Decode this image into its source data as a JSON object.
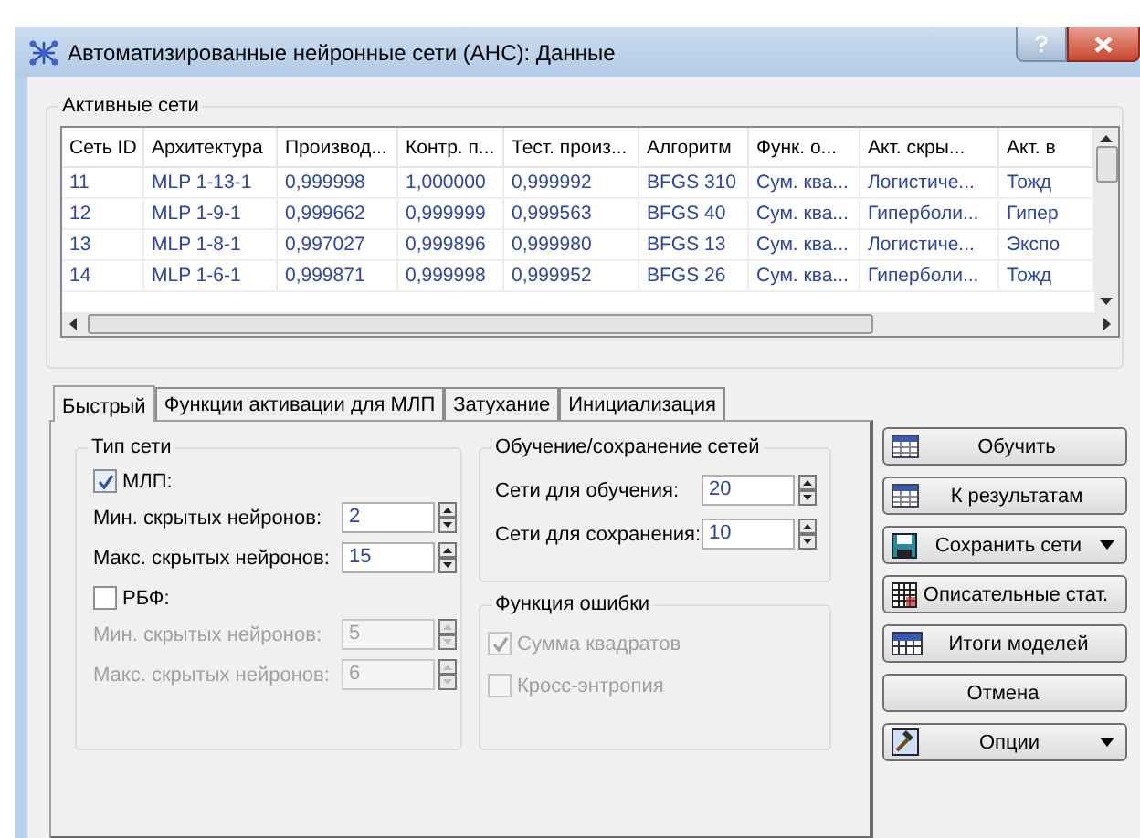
{
  "window": {
    "title": "Автоматизированные нейронные сети (АНС): Данные"
  },
  "active_networks": {
    "title": "Активные сети",
    "columns": [
      "Сеть ID",
      "Архитектура",
      "Производ...",
      "Контр. п...",
      "Тест. произ...",
      "Алгоритм",
      "Функ. о...",
      "Акт. скры...",
      "Акт. в"
    ],
    "rows": [
      [
        "11",
        "MLP 1-13-1",
        "0,999998",
        "1,000000",
        "0,999992",
        "BFGS 310",
        "Сум. ква...",
        "Логистиче...",
        "Тожд"
      ],
      [
        "12",
        "MLP 1-9-1",
        "0,999662",
        "0,999999",
        "0,999563",
        "BFGS 40",
        "Сум. ква...",
        "Гиперболи...",
        "Гипер"
      ],
      [
        "13",
        "MLP 1-8-1",
        "0,997027",
        "0,999896",
        "0,999980",
        "BFGS 13",
        "Сум. ква...",
        "Логистиче...",
        "Экспо"
      ],
      [
        "14",
        "MLP 1-6-1",
        "0,999871",
        "0,999998",
        "0,999952",
        "BFGS 26",
        "Сум. ква...",
        "Гиперболи...",
        "Тожд"
      ]
    ]
  },
  "tabs": [
    {
      "label": "Быстрый",
      "selected": true
    },
    {
      "label": "Функции активации для МЛП",
      "selected": false
    },
    {
      "label": "Затухание",
      "selected": false
    },
    {
      "label": "Инициализация",
      "selected": false
    }
  ],
  "network_type": {
    "title": "Тип сети",
    "sections": [
      {
        "label": "МЛП:",
        "checked": true,
        "fields": [
          {
            "label": "Мин. скрытых нейронов:",
            "value": "2",
            "disabled": false
          },
          {
            "label": "Макс. скрытых нейронов:",
            "value": "15",
            "disabled": false
          }
        ]
      },
      {
        "label": "РБФ:",
        "checked": false,
        "fields": [
          {
            "label": "Мин. скрытых нейронов:",
            "value": "5",
            "disabled": true
          },
          {
            "label": "Макс. скрытых нейронов:",
            "value": "6",
            "disabled": true
          }
        ]
      }
    ]
  },
  "training": {
    "title": "Обучение/сохранение сетей",
    "fields": [
      {
        "label": "Сети для обучения:",
        "value": "20",
        "disabled": false
      },
      {
        "label": "Сети для сохранения:",
        "value": "10",
        "disabled": false
      }
    ]
  },
  "error_function": {
    "title": "Функция ошибки",
    "options": [
      {
        "label": "Сумма квадратов",
        "checked": true,
        "disabled": true
      },
      {
        "label": "Кросс-энтропия",
        "checked": false,
        "disabled": true
      }
    ]
  },
  "buttons": [
    {
      "label": "Обучить",
      "kind": "grid",
      "dropdown": false
    },
    {
      "label": "К результатам",
      "kind": "grid",
      "dropdown": false
    },
    {
      "label": "Сохранить сети",
      "kind": "disk",
      "dropdown": true
    },
    {
      "label": "Описательные стат.",
      "kind": "table",
      "dropdown": false
    },
    {
      "label": "Итоги моделей",
      "kind": "sum",
      "dropdown": false
    },
    {
      "label": "Отмена",
      "kind": "plain",
      "dropdown": false
    },
    {
      "label": "Опции",
      "kind": "hammer",
      "dropdown": true
    }
  ]
}
